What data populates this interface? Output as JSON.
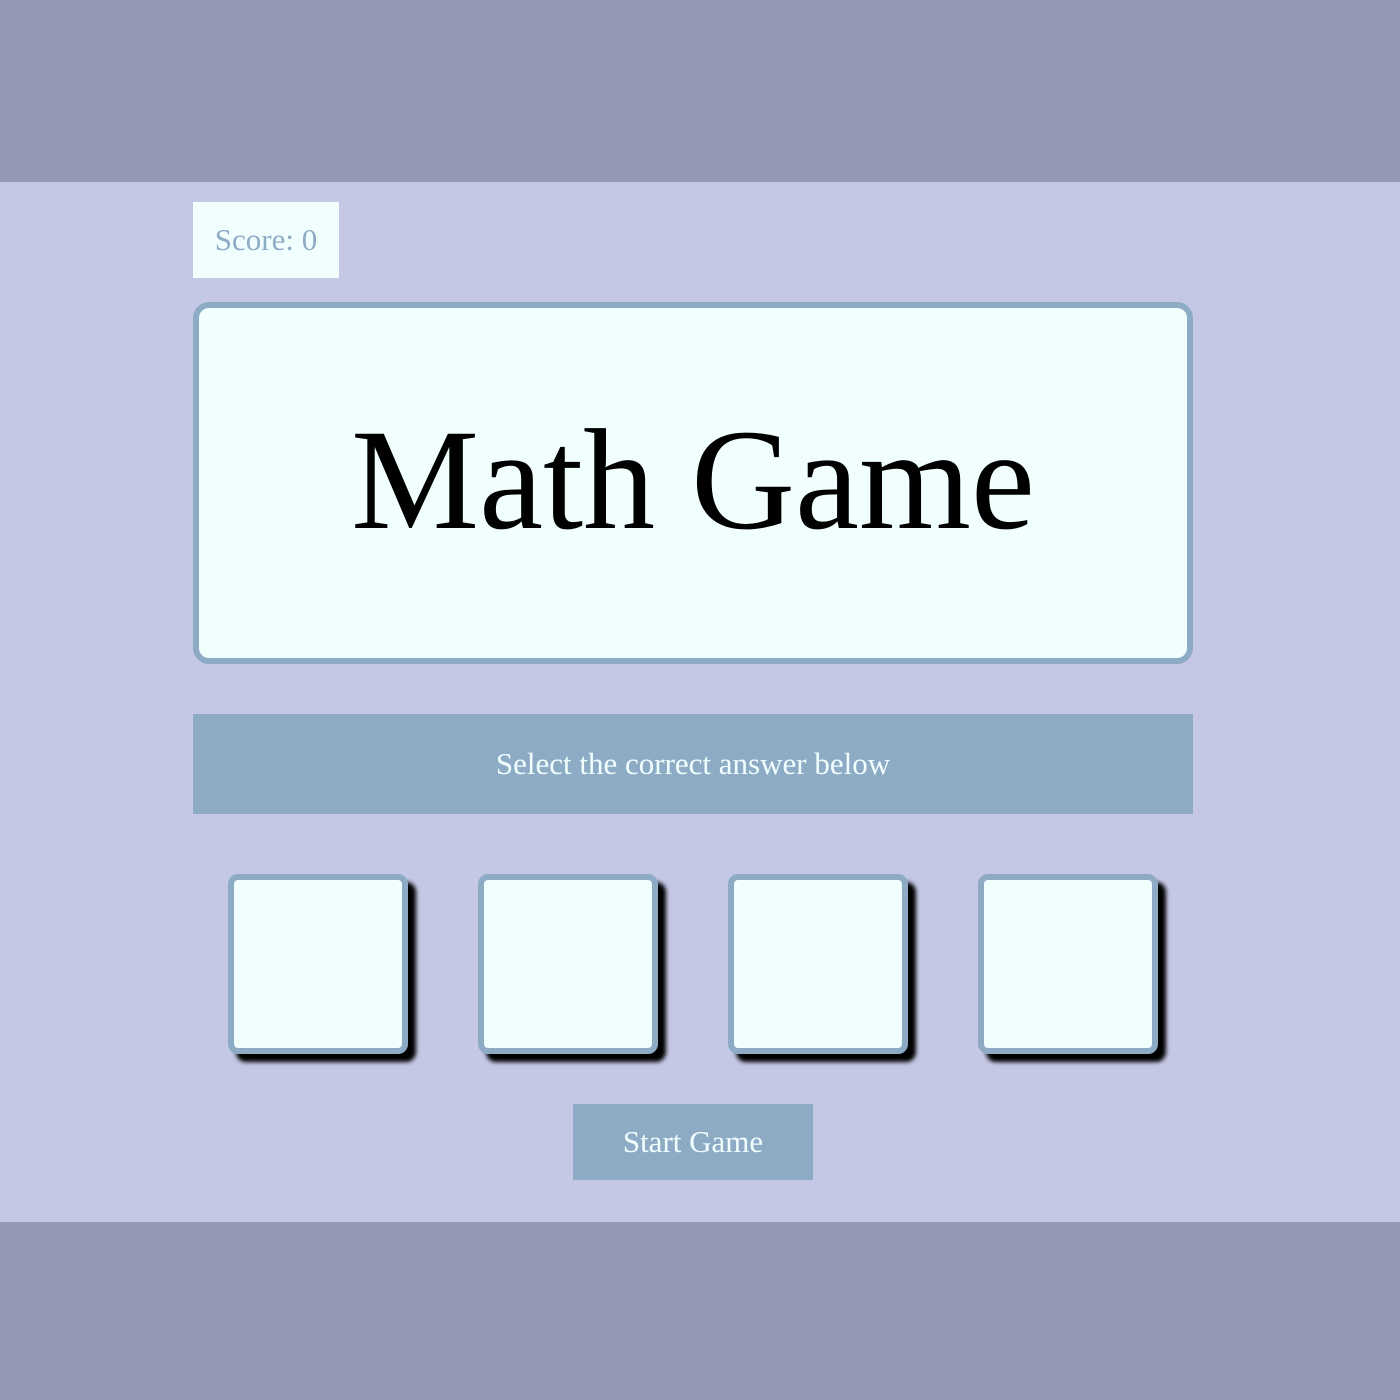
{
  "score": {
    "text": "Score: 0"
  },
  "question": {
    "text": "Math Game"
  },
  "instruction": {
    "text": "Select the correct answer below"
  },
  "choices": [
    {
      "label": ""
    },
    {
      "label": ""
    },
    {
      "label": ""
    },
    {
      "label": ""
    }
  ],
  "start_button": {
    "label": "Start Game"
  },
  "colors": {
    "outer_band": "#9598b4",
    "container": "#c5c8e5",
    "panel": "#f0fffe",
    "accent": "#8eabc6",
    "text_dark": "#000000"
  }
}
